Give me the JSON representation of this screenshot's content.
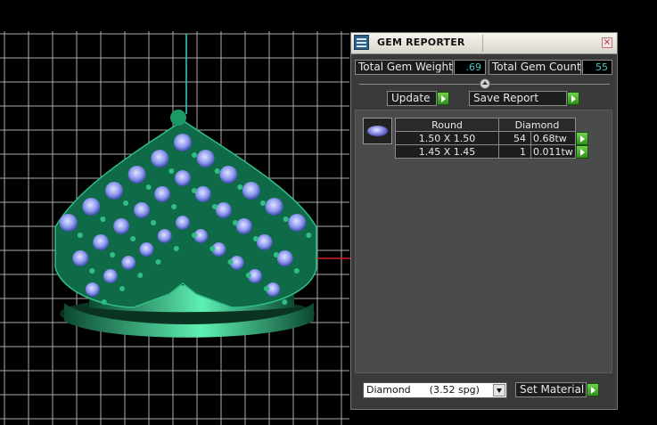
{
  "panel": {
    "title": "GEM REPORTER",
    "close_symbol": "×",
    "total_weight_label": "Total Gem Weight",
    "total_weight_value": ".69",
    "total_count_label": "Total Gem Count",
    "total_count_value": "55",
    "update_label": "Update",
    "save_report_label": "Save Report",
    "table": {
      "headers": [
        "Round",
        "Diamond"
      ],
      "rows": [
        {
          "size": "1.50 X 1.50",
          "count": "54",
          "weight": "0.68tw"
        },
        {
          "size": "1.45 X 1.45",
          "count": "1",
          "weight": "0.011tw"
        }
      ]
    },
    "material_select": {
      "gem": "Diamond",
      "density": "(3.52 spg)"
    },
    "set_material_label": "Set Material"
  },
  "colors": {
    "panel_bg": "#3a3a3a",
    "value_text": "#46c7c7",
    "go_button": "#4cb431",
    "model_green": "#1f9a6a",
    "gem_blue": "#9aa6f2",
    "grid": "#d0d0d0",
    "axis_cyan": "#2fd0d0",
    "axis_red": "#d02020"
  },
  "icons": {
    "app": "gem-reporter-icon",
    "close": "close-icon",
    "go": "green-arrow-right-icon",
    "collapse": "collapse-arrow-icon",
    "dropdown": "chevron-down-icon"
  }
}
